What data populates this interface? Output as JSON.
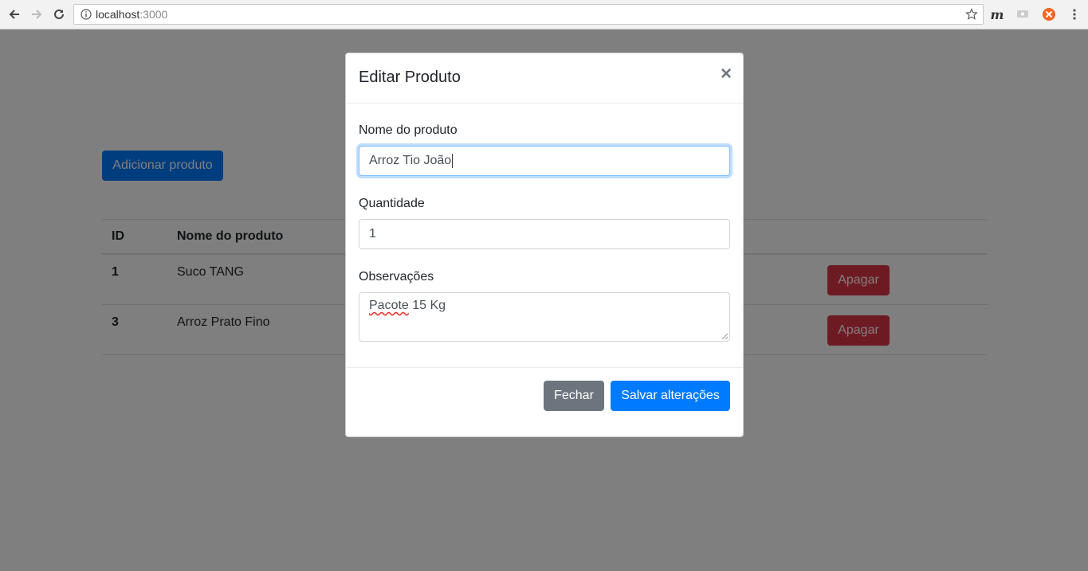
{
  "browser": {
    "url_host": "localhost",
    "url_port": ":3000",
    "extensions": [
      "m-extension-icon",
      "cast-icon",
      "orange-extension-icon",
      "menu-dots-icon"
    ]
  },
  "page": {
    "add_button": "Adicionar produto",
    "table": {
      "headers": [
        "ID",
        "Nome do produto"
      ],
      "rows": [
        {
          "id": "1",
          "name": "Suco TANG",
          "action": "Apagar"
        },
        {
          "id": "3",
          "name": "Arroz Prato Fino",
          "action": "Apagar"
        }
      ]
    }
  },
  "modal": {
    "title": "Editar Produto",
    "close": "×",
    "fields": {
      "name_label": "Nome do produto",
      "name_value": "Arroz Tio João",
      "qty_label": "Quantidade",
      "qty_value": "1",
      "notes_label": "Observações",
      "notes_word1": "Pacote",
      "notes_rest": " 15 Kg"
    },
    "footer": {
      "close_button": "Fechar",
      "save_button": "Salvar alterações"
    }
  },
  "colors": {
    "primary": "#007bff",
    "danger": "#dc3545",
    "secondary": "#6c757d",
    "backdrop": "rgba(0,0,0,0.5)"
  }
}
